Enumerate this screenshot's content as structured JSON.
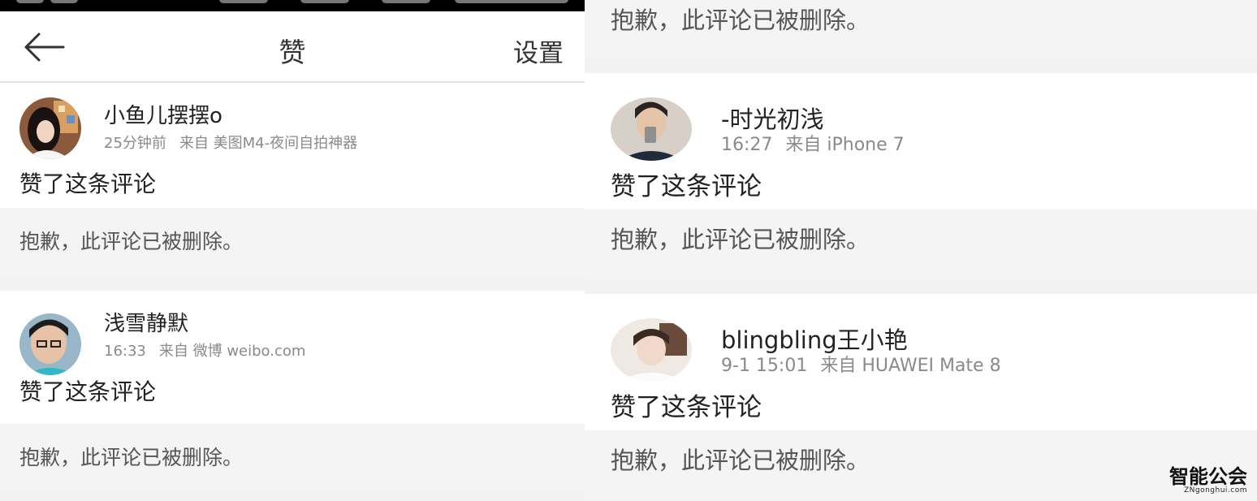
{
  "header": {
    "title": "赞",
    "settings_label": "设置"
  },
  "deleted_text": "抱歉，此评论已被删除。",
  "left_items": [
    {
      "username": "小鱼儿摆摆o",
      "time": "25分钟前",
      "source": "来自 美图M4-夜间自拍神器",
      "action": "赞了这条评论"
    },
    {
      "username": "浅雪静默",
      "time": "16:33",
      "source": "来自 微博 weibo.com",
      "action": "赞了这条评论"
    }
  ],
  "right_items": [
    {
      "username": "-时光初浅",
      "time": "16:27",
      "source": "来自 iPhone 7",
      "action": "赞了这条评论"
    },
    {
      "username": "blingbling王小艳",
      "time": "9-1 15:01",
      "source": "来自 HUAWEI Mate 8",
      "action": "赞了这条评论"
    }
  ],
  "watermark": {
    "logo": "智能公会",
    "url": "ZNgonghui.com"
  },
  "colors": {
    "background": "#f2f2f2",
    "card": "#ffffff",
    "deleted_bg": "#f4f4f4",
    "meta_text": "#8a8a8a",
    "status_bar": "#000000"
  }
}
